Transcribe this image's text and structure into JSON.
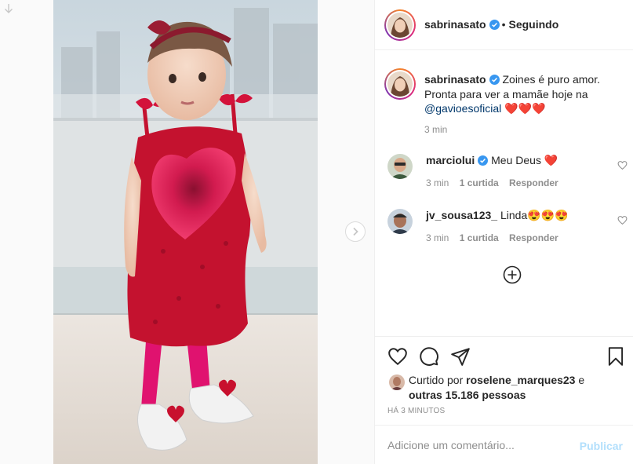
{
  "post": {
    "author": "sabrinasato",
    "follow_status": "Seguindo",
    "header_dot": "•",
    "caption_text": "Zoines é puro amor. Pronta para ver a mamãe hoje na",
    "caption_mention": "@gavioesoficial",
    "caption_emoji": "❤️❤️❤️",
    "caption_time": "3 min"
  },
  "comments": [
    {
      "username": "marciolui",
      "verified": true,
      "text": "Meu Deus",
      "emoji": "❤️",
      "time": "3 min",
      "likes": "1 curtida",
      "reply": "Responder"
    },
    {
      "username": "jv_sousa123_",
      "verified": false,
      "text": "Linda",
      "emoji": "😍😍😍",
      "time": "3 min",
      "likes": "1 curtida",
      "reply": "Responder"
    }
  ],
  "likes": {
    "prefix": "Curtido por",
    "first_user": "roselene_marques23",
    "joiner": "e",
    "others": "outras 15.186 pessoas"
  },
  "timestamp": "HÁ 3 MINUTOS",
  "comment_box": {
    "placeholder": "Adicione um comentário...",
    "publish": "Publicar"
  },
  "icons": {
    "like": "heart-outline-icon",
    "comment": "speech-bubble-icon",
    "share": "paper-plane-icon",
    "save": "bookmark-icon",
    "more_comments": "plus-circle-icon",
    "next": "chevron-right-icon"
  },
  "colors": {
    "link": "#00376b",
    "muted": "#8e8e8e",
    "publish_disabled": "#b2dffc",
    "verified": "#3897f0"
  }
}
